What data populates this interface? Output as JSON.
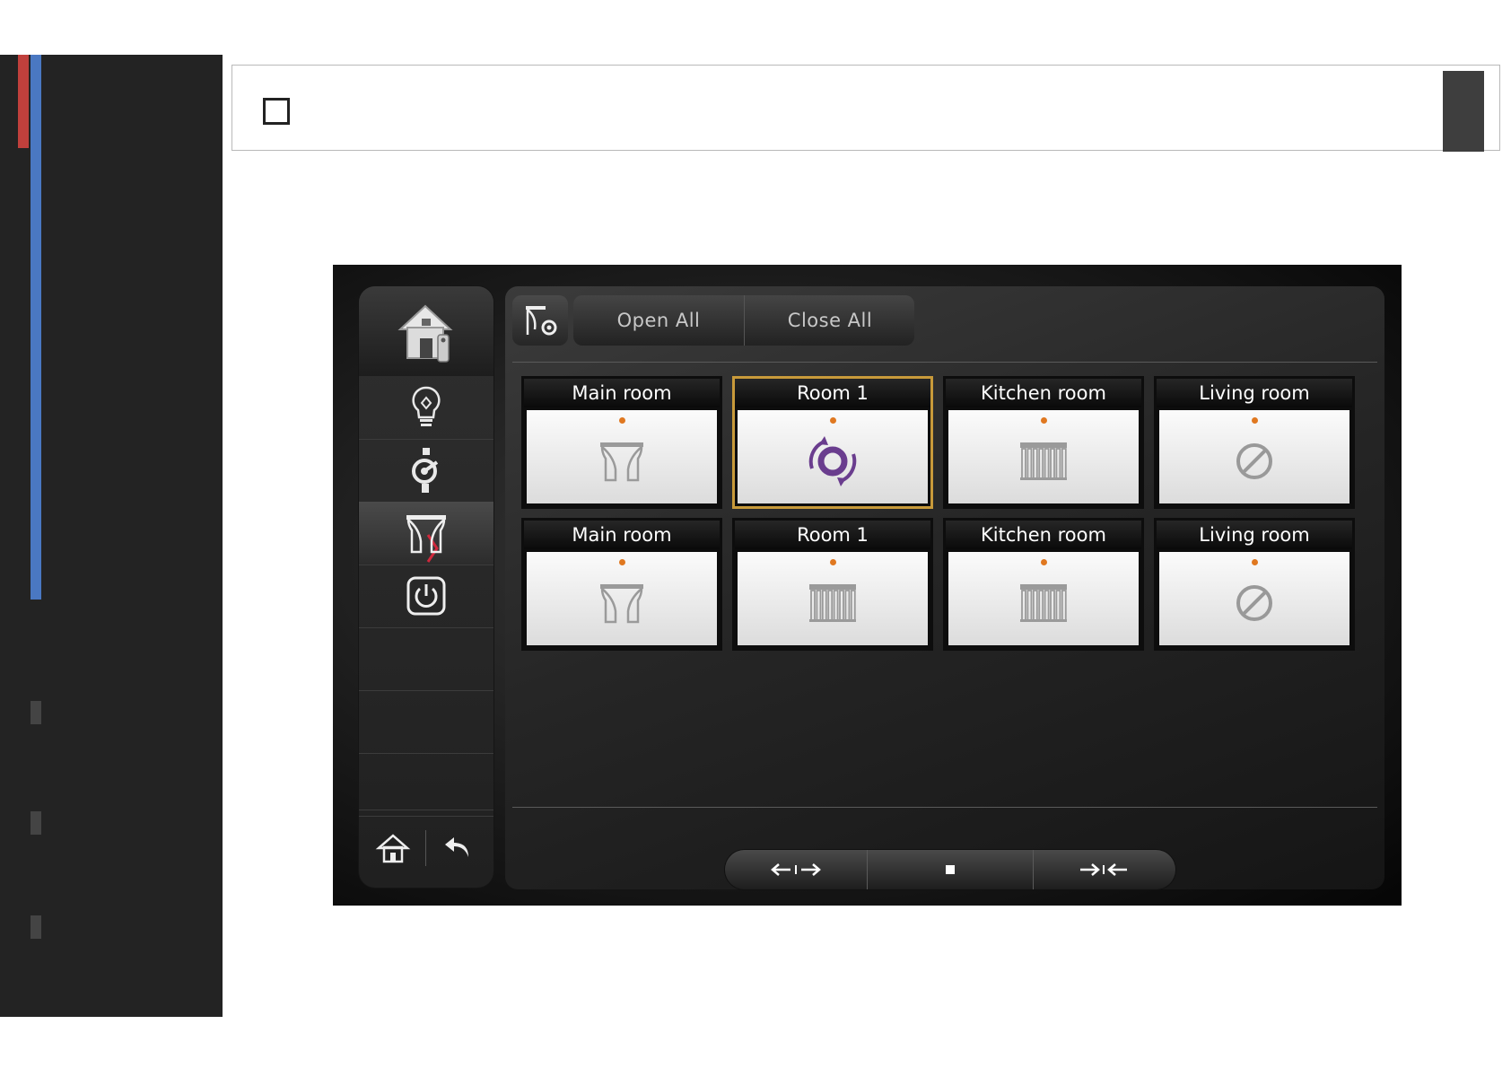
{
  "toolbar": {
    "open_all": "Open All",
    "close_all": "Close All"
  },
  "rooms": [
    {
      "name": "Main room",
      "icon": "curtain-icon",
      "selected": false
    },
    {
      "name": "Room 1",
      "icon": "moving-spinner-icon",
      "selected": true
    },
    {
      "name": "Kitchen room",
      "icon": "blind-icon",
      "selected": false
    },
    {
      "name": "Living room",
      "icon": "disabled-icon",
      "selected": false
    },
    {
      "name": "Main room",
      "icon": "curtain-icon",
      "selected": false
    },
    {
      "name": "Room 1",
      "icon": "blind-icon",
      "selected": false
    },
    {
      "name": "Kitchen room",
      "icon": "blind-icon",
      "selected": false
    },
    {
      "name": "Living room",
      "icon": "disabled-icon",
      "selected": false
    }
  ],
  "nav": {
    "items": [
      "home-remote-icon",
      "light-bulb-icon",
      "climate-icon",
      "curtain-icon",
      "power-icon"
    ],
    "active": "curtain-icon"
  },
  "colors": {
    "selected_border": "#c89a3a",
    "status_dot": "#e07820",
    "spinner": "#6a3d8e",
    "rail_red": "#c0403c",
    "rail_blue": "#4a78c2"
  }
}
